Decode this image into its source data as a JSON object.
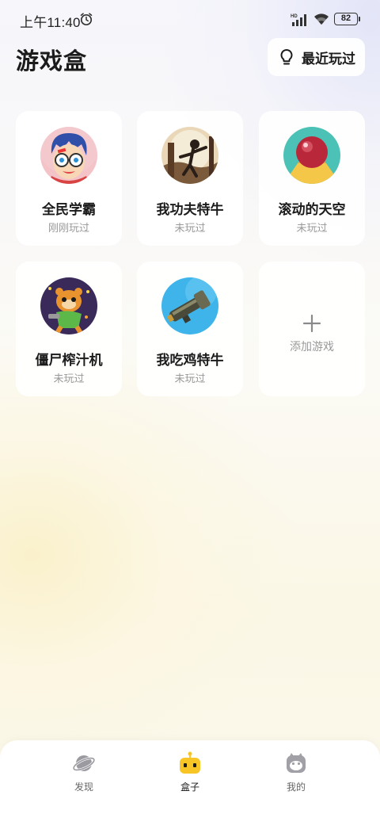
{
  "status_bar": {
    "time": "上午11:40",
    "battery": "82",
    "alarm_icon": "alarm-clock-icon",
    "signal_icon": "signal-bars-icon",
    "wifi_icon": "wifi-icon"
  },
  "header": {
    "title": "游戏盒",
    "recent_button": {
      "label": "最近玩过",
      "icon": "lightbulb-icon"
    }
  },
  "games": [
    {
      "name": "全民学霸",
      "status": "刚刚玩过"
    },
    {
      "name": "我功夫特牛",
      "status": "未玩过"
    },
    {
      "name": "滚动的天空",
      "status": "未玩过"
    },
    {
      "name": "僵尸榨汁机",
      "status": "未玩过"
    },
    {
      "name": "我吃鸡特牛",
      "status": "未玩过"
    }
  ],
  "add_game": {
    "label": "添加游戏",
    "icon": "plus-icon"
  },
  "bottom_nav": {
    "items": [
      {
        "label": "发现",
        "icon": "planet-icon",
        "active": false
      },
      {
        "label": "盒子",
        "icon": "robot-icon",
        "active": true
      },
      {
        "label": "我的",
        "icon": "profile-face-icon",
        "active": false
      }
    ]
  },
  "colors": {
    "accent_yellow": "#f7c525",
    "text_primary": "#1b1b1b",
    "text_secondary": "#999999"
  }
}
